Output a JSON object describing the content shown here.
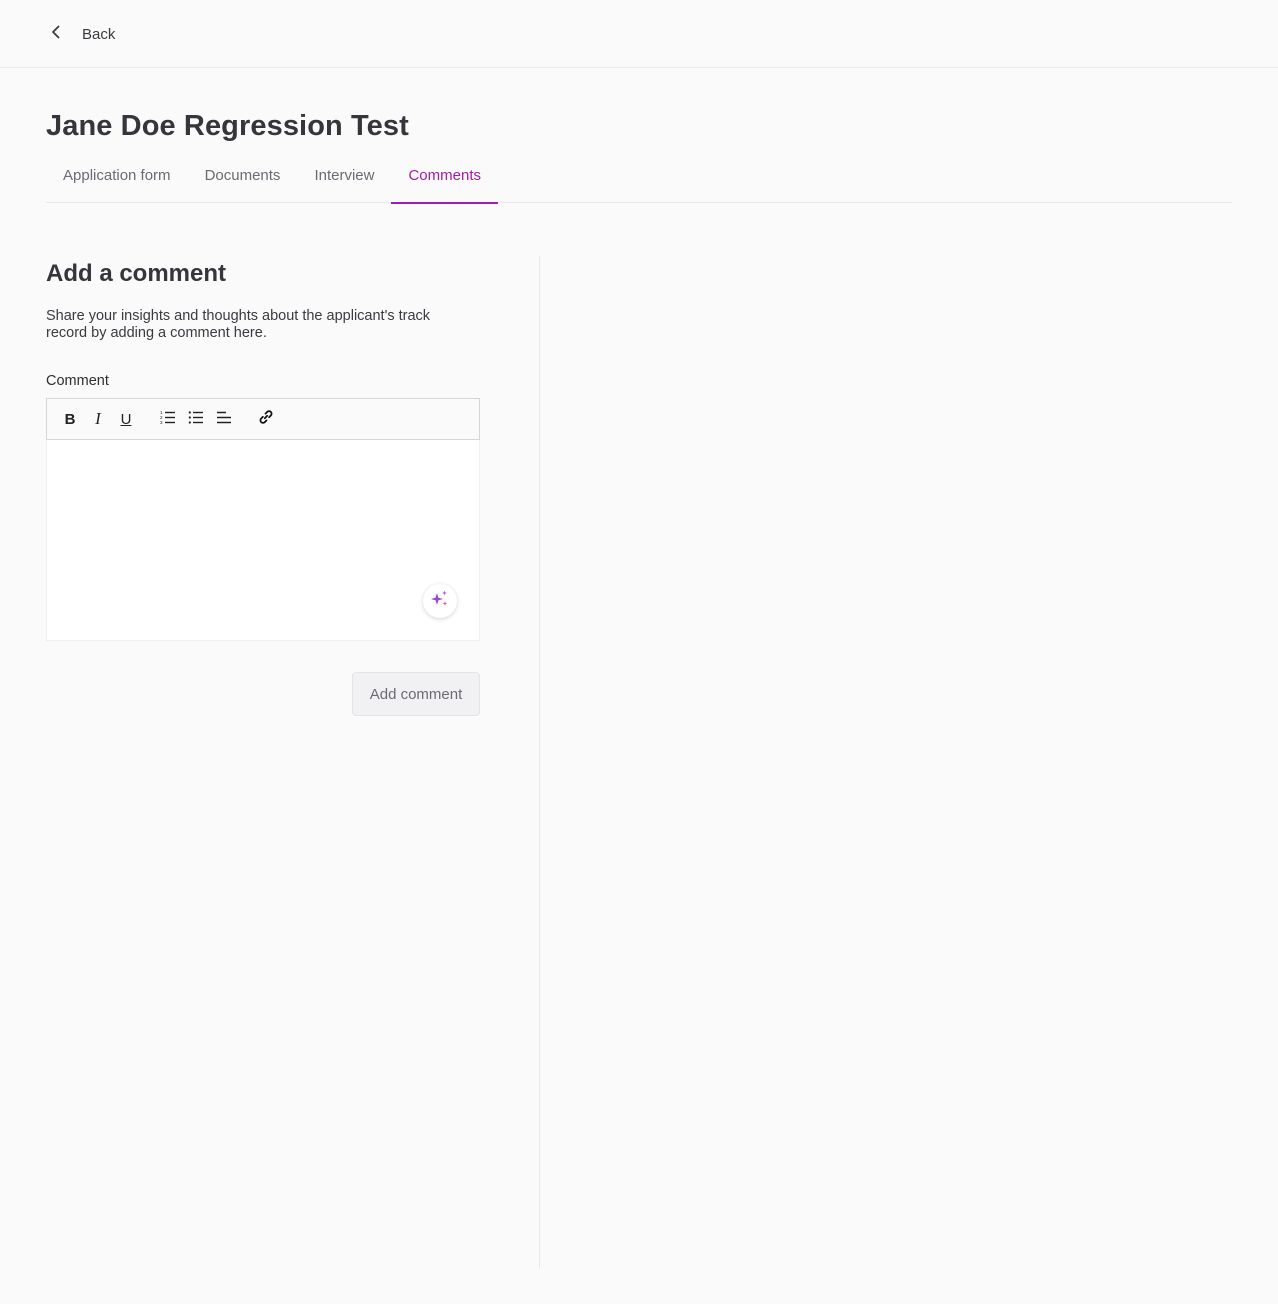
{
  "topbar": {
    "back_label": "Back"
  },
  "applicant": {
    "name": "Jane Doe Regression Test"
  },
  "tabs": [
    {
      "label": "Application form",
      "active": false
    },
    {
      "label": "Documents",
      "active": false
    },
    {
      "label": "Interview",
      "active": false
    },
    {
      "label": "Comments",
      "active": true
    }
  ],
  "comment_section": {
    "title": "Add a comment",
    "description": "Share your insights and thoughts about the applicant's track record by adding a comment here.",
    "field_label": "Comment",
    "field_value": "",
    "toolbar": {
      "bold": "B",
      "italic": "I",
      "underline": "U",
      "icons": [
        "ordered-list-icon",
        "bullet-list-icon",
        "align-left-icon",
        "link-icon"
      ]
    },
    "ai_icon": "sparkles-icon",
    "submit_label": "Add comment"
  },
  "colors": {
    "accent": "#a21caf",
    "background": "#fafafa",
    "button_disabled_bg": "#f1f0f3"
  }
}
